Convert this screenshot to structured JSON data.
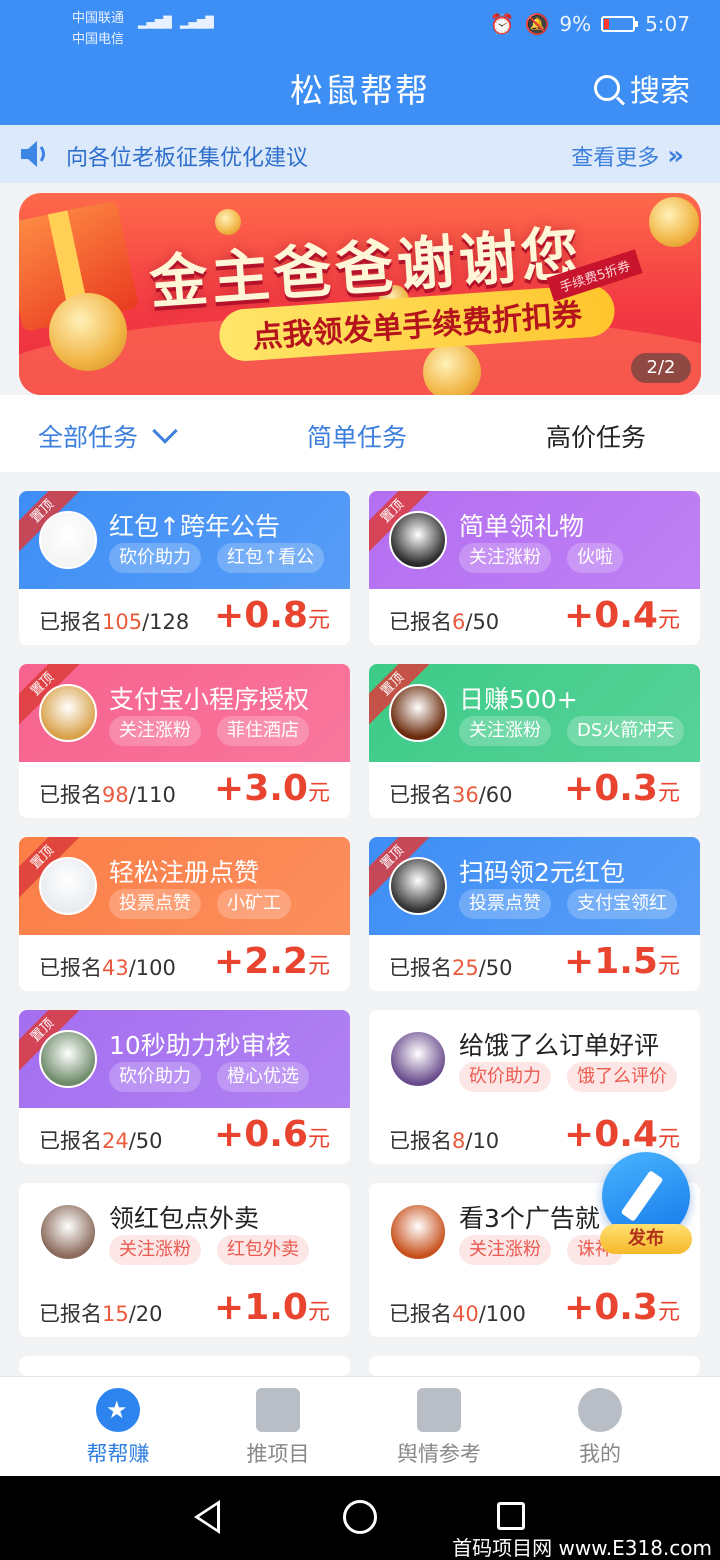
{
  "status_bar": {
    "carrier1": "中国联通",
    "carrier2": "中国电信",
    "battery": "9%",
    "time": "5:07"
  },
  "header": {
    "title": "松鼠帮帮",
    "search_label": "搜索"
  },
  "notice": {
    "text": "向各位老板征集优化建议",
    "more": "查看更多"
  },
  "banner": {
    "main_text": "金主爸爸谢谢您",
    "sub_text": "点我领发单手续费折扣券",
    "ticket_text": "手续费5折券",
    "page_indicator": "2/2"
  },
  "tabs": {
    "all": "全部任务",
    "simple": "简单任务",
    "high_price": "高价任务"
  },
  "tasks": [
    {
      "title": "红包↑跨年公告",
      "tags": [
        "砍价助力",
        "红包↑看公"
      ],
      "enrolled": "105",
      "total": "/128",
      "price": "+0.8",
      "unit": "元",
      "pinned": "置顶",
      "color": "#3e8ef6"
    },
    {
      "title": "简单领礼物",
      "tags": [
        "关注涨粉",
        "伙啦"
      ],
      "enrolled": "6",
      "total": "/50",
      "price": "+0.4",
      "unit": "元",
      "pinned": "置顶",
      "color": "#b46ef2"
    },
    {
      "title": "支付宝小程序授权",
      "tags": [
        "关注涨粉",
        "菲住酒店"
      ],
      "enrolled": "98",
      "total": "/110",
      "price": "+3.0",
      "unit": "元",
      "pinned": "置顶",
      "color": "#f7628e"
    },
    {
      "title": "日赚500+",
      "tags": [
        "关注涨粉",
        "DS火箭冲天"
      ],
      "enrolled": "36",
      "total": "/60",
      "price": "+0.3",
      "unit": "元",
      "pinned": "置顶",
      "color": "#3dcb88"
    },
    {
      "title": "轻松注册点赞",
      "tags": [
        "投票点赞",
        "小矿工"
      ],
      "enrolled": "43",
      "total": "/100",
      "price": "+2.2",
      "unit": "元",
      "pinned": "置顶",
      "color": "#fb7e46"
    },
    {
      "title": "扫码领2元红包",
      "tags": [
        "投票点赞",
        "支付宝领红"
      ],
      "enrolled": "25",
      "total": "/50",
      "price": "+1.5",
      "unit": "元",
      "pinned": "置顶",
      "color": "#3e8ef6"
    },
    {
      "title": "10秒助力秒审核",
      "tags": [
        "砍价助力",
        "橙心优选"
      ],
      "enrolled": "24",
      "total": "/50",
      "price": "+0.6",
      "unit": "元",
      "pinned": "置顶",
      "color": "#a46ef0"
    },
    {
      "title": "给饿了么订单好评",
      "tags": [
        "砍价助力",
        "饿了么评价"
      ],
      "enrolled": "8",
      "total": "/10",
      "price": "+0.4",
      "unit": "元",
      "pinned": "",
      "color": ""
    },
    {
      "title": "领红包点外卖",
      "tags": [
        "关注涨粉",
        "红包外卖"
      ],
      "enrolled": "15",
      "total": "/20",
      "price": "+1.0",
      "unit": "元",
      "pinned": "",
      "color": ""
    },
    {
      "title": "看3个广告就",
      "tags": [
        "关注涨粉",
        "诛神"
      ],
      "enrolled": "40",
      "total": "/100",
      "price": "+0.3",
      "unit": "元",
      "pinned": "",
      "color": ""
    }
  ],
  "enroll_label": "已报名",
  "fab": {
    "label": "发布"
  },
  "bottom_nav": [
    {
      "label": "帮帮赚",
      "icon": "star-icon",
      "active": true
    },
    {
      "label": "推项目",
      "icon": "document-icon",
      "active": false
    },
    {
      "label": "舆情参考",
      "icon": "book-icon",
      "active": false
    },
    {
      "label": "我的",
      "icon": "user-icon",
      "active": false
    }
  ],
  "watermark": "首码项目网 www.E318.com"
}
